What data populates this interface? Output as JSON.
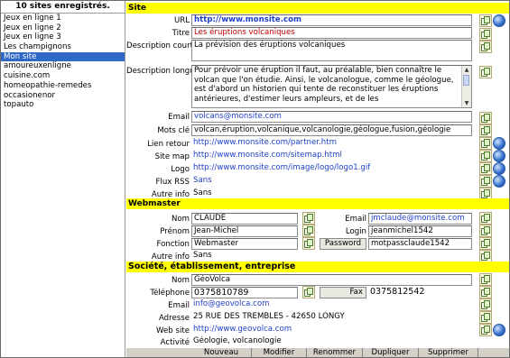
{
  "sidebar": {
    "header": "10 sites enregistrés.",
    "items": [
      "Jeux en ligne 1",
      "Jeux en ligne 2",
      "Jeux en ligne 3",
      "Les champignons",
      "Mon site",
      "amoureuxenligne",
      "cuisine.com",
      "homeopathie-remedes",
      "occasionenor",
      "topauto"
    ]
  },
  "site": {
    "section": "Site",
    "url_label": "URL",
    "url": "http://www.monsite.com",
    "titre_label": "Titre",
    "titre": "Les éruptions volcaniques",
    "desc_courte_label": "Description courte",
    "desc_courte": "La prévision des éruptions volcaniques",
    "desc_longue_label": "Description longue",
    "desc_longue": "Pour prévoir une éruption il faut, au préalable, bien connaître le volcan que l'on étudie. Ainsi, le volcanologue, comme le géologue, est d'abord un historien qui tente de reconstituer les éruptions antérieures, d'estimer leurs ampleurs, et de les",
    "email_label": "Email",
    "email": "volcans@monsite.com",
    "mots_label": "Mots clé",
    "mots": "volcan,éruption,volcanique,volcanologie,géologue,fusion,géologie",
    "lien_label": "Lien retour",
    "lien": "http://www.monsite.com/partner.htm",
    "sitemap_label": "Site map",
    "sitemap": "http://www.monsite.com/sitemap.html",
    "logo_label": "Logo",
    "logo": "http://www.monsite.com/image/logo/logo1.gif",
    "rss_label": "Flux RSS",
    "rss": "Sans",
    "autre_label": "Autre info",
    "autre": "Sans"
  },
  "webmaster": {
    "section": "Webmaster",
    "nom_label": "Nom",
    "nom": "CLAUDE",
    "prenom_label": "Prénom",
    "prenom": "Jean-Michel",
    "fonction_label": "Fonction",
    "fonction": "Webmaster",
    "email_label": "Email",
    "email": "jmclaude@monsite.com",
    "login_label": "Login",
    "login": "jeanmichel1542",
    "password_label": "Password",
    "password": "motpassclaude1542",
    "autre_label": "Autre info",
    "autre": "Sans"
  },
  "societe": {
    "section": "Société, établissement, entreprise",
    "nom_label": "Nom",
    "nom": "GéoVolca",
    "tel_label": "Téléphone",
    "tel": "0375810789",
    "fax_label": "Fax",
    "fax": "0375812542",
    "email_label": "Email",
    "email": "info@geovolca.com",
    "adresse_label": "Adresse",
    "adresse": "25 RUE DES TREMBLES - 42650 LONGY",
    "web_label": "Web site",
    "web": "http://www.geovolca.com",
    "activite_label": "Activité",
    "activite": "Géologie, volcanologie"
  },
  "toolbar": {
    "nouveau": "Nouveau",
    "modifier": "Modifier",
    "renommer": "Renommer",
    "dupliquer": "Dupliquer",
    "supprimer": "Supprimer"
  },
  "colors": {
    "section_bg": "#ffff00",
    "selection_bg": "#3169c6",
    "link_blue": "#1e3fc9",
    "title_red": "#c00000"
  },
  "icons": [
    "copy-icon",
    "web-icon"
  ]
}
